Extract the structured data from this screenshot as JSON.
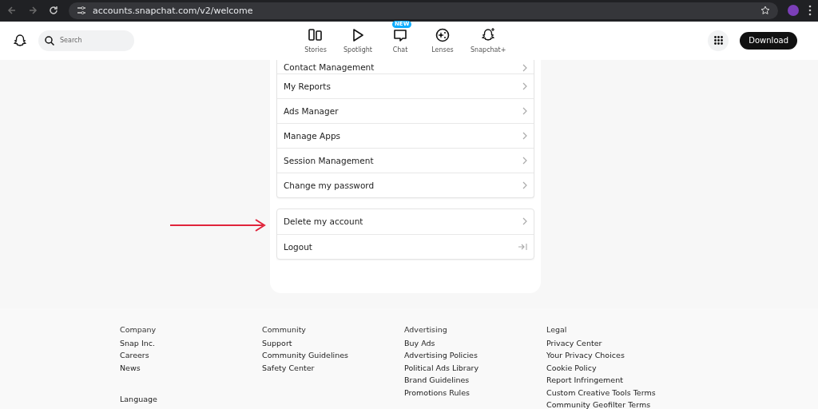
{
  "browser": {
    "url": "accounts.snapchat.com/v2/welcome"
  },
  "header": {
    "search": {
      "placeholder": "Search"
    },
    "nav": [
      {
        "label": "Stories",
        "kind": "stories"
      },
      {
        "label": "Spotlight",
        "kind": "spotlight"
      },
      {
        "label": "Chat",
        "kind": "chat",
        "badge": "NEW"
      },
      {
        "label": "Lenses",
        "kind": "lenses"
      },
      {
        "label": "Snapchat+",
        "kind": "plus"
      }
    ],
    "download": "Download"
  },
  "menu": {
    "groups": [
      {
        "items": [
          {
            "label": "Contact Management",
            "kind": "chevron"
          },
          {
            "label": "My Reports",
            "kind": "chevron"
          },
          {
            "label": "Ads Manager",
            "kind": "chevron"
          },
          {
            "label": "Manage Apps",
            "kind": "chevron"
          },
          {
            "label": "Session Management",
            "kind": "chevron"
          },
          {
            "label": "Change my password",
            "kind": "chevron"
          }
        ]
      },
      {
        "items": [
          {
            "label": "Delete my account",
            "kind": "chevron"
          },
          {
            "label": "Logout",
            "kind": "logout"
          }
        ]
      }
    ]
  },
  "footer": {
    "columns": [
      {
        "heading": "Company",
        "links": [
          "Snap Inc.",
          "Careers",
          "News"
        ]
      },
      {
        "heading": "Community",
        "links": [
          "Support",
          "Community Guidelines",
          "Safety Center"
        ]
      },
      {
        "heading": "Advertising",
        "links": [
          "Buy Ads",
          "Advertising Policies",
          "Political Ads Library",
          "Brand Guidelines",
          "Promotions Rules"
        ]
      },
      {
        "heading": "Legal",
        "links": [
          "Privacy Center",
          "Your Privacy Choices",
          "Cookie Policy",
          "Report Infringement",
          "Custom Creative Tools Terms",
          "Community Geofilter Terms"
        ]
      }
    ],
    "language": "Language"
  }
}
